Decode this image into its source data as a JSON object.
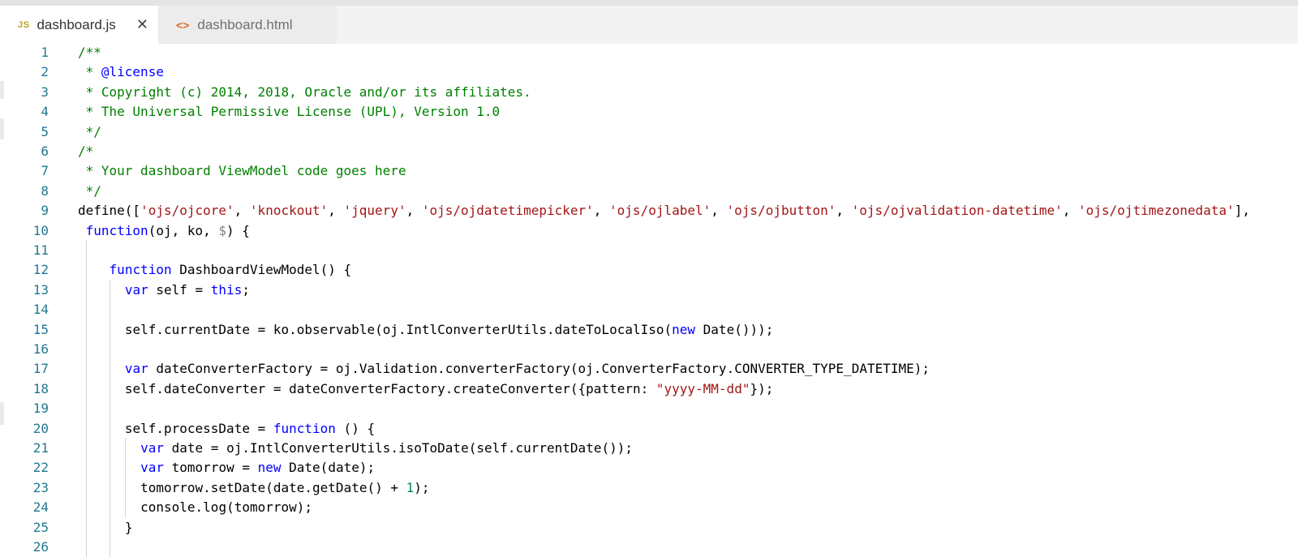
{
  "tabs": [
    {
      "icon": "JS",
      "label": "dashboard.js",
      "active": true,
      "close": "✕"
    },
    {
      "icon": "<>",
      "label": "dashboard.html",
      "active": false
    }
  ],
  "editor": {
    "lines": [
      {
        "num": "1",
        "indent": 0,
        "tokens": [
          {
            "t": "c",
            "v": "/**"
          }
        ]
      },
      {
        "num": "2",
        "indent": 1,
        "tokens": [
          {
            "t": "c",
            "v": "* "
          },
          {
            "t": "g",
            "v": "@license"
          }
        ]
      },
      {
        "num": "3",
        "indent": 1,
        "tokens": [
          {
            "t": "c",
            "v": "* Copyright (c) 2014, 2018, Oracle and/or its affiliates."
          }
        ]
      },
      {
        "num": "4",
        "indent": 1,
        "tokens": [
          {
            "t": "c",
            "v": "* The Universal Permissive License (UPL), Version 1.0"
          }
        ]
      },
      {
        "num": "5",
        "indent": 1,
        "tokens": [
          {
            "t": "c",
            "v": "*/"
          }
        ]
      },
      {
        "num": "6",
        "indent": 0,
        "tokens": [
          {
            "t": "c",
            "v": "/*"
          }
        ]
      },
      {
        "num": "7",
        "indent": 1,
        "tokens": [
          {
            "t": "c",
            "v": "* Your dashboard ViewModel code goes here"
          }
        ]
      },
      {
        "num": "8",
        "indent": 1,
        "tokens": [
          {
            "t": "c",
            "v": "*/"
          }
        ]
      },
      {
        "num": "9",
        "indent": 0,
        "tokens": [
          {
            "t": "p",
            "v": "define(["
          },
          {
            "t": "s",
            "v": "'ojs/ojcore'"
          },
          {
            "t": "p",
            "v": ", "
          },
          {
            "t": "s",
            "v": "'knockout'"
          },
          {
            "t": "p",
            "v": ", "
          },
          {
            "t": "s",
            "v": "'jquery'"
          },
          {
            "t": "p",
            "v": ", "
          },
          {
            "t": "s",
            "v": "'ojs/ojdatetimepicker'"
          },
          {
            "t": "p",
            "v": ", "
          },
          {
            "t": "s",
            "v": "'ojs/ojlabel'"
          },
          {
            "t": "p",
            "v": ", "
          },
          {
            "t": "s",
            "v": "'ojs/ojbutton'"
          },
          {
            "t": "p",
            "v": ", "
          },
          {
            "t": "s",
            "v": "'ojs/ojvalidation-datetime'"
          },
          {
            "t": "p",
            "v": ", "
          },
          {
            "t": "s",
            "v": "'ojs/ojtimezonedata'"
          },
          {
            "t": "p",
            "v": "],"
          }
        ]
      },
      {
        "num": "10",
        "indent": 1,
        "tokens": [
          {
            "t": "k",
            "v": "function"
          },
          {
            "t": "p",
            "v": "(oj, ko, "
          },
          {
            "t": "d",
            "v": "$"
          },
          {
            "t": "p",
            "v": ") {"
          }
        ]
      },
      {
        "num": "11",
        "indent": 1,
        "guides": [
          1
        ],
        "tokens": []
      },
      {
        "num": "12",
        "indent": 4,
        "guides": [
          1
        ],
        "tokens": [
          {
            "t": "k",
            "v": "function"
          },
          {
            "t": "p",
            "v": " DashboardViewModel() {"
          }
        ]
      },
      {
        "num": "13",
        "indent": 6,
        "guides": [
          1,
          4
        ],
        "tokens": [
          {
            "t": "k",
            "v": "var"
          },
          {
            "t": "p",
            "v": " self = "
          },
          {
            "t": "k",
            "v": "this"
          },
          {
            "t": "p",
            "v": ";"
          }
        ]
      },
      {
        "num": "14",
        "indent": 6,
        "guides": [
          1,
          4
        ],
        "tokens": []
      },
      {
        "num": "15",
        "indent": 6,
        "guides": [
          1,
          4
        ],
        "tokens": [
          {
            "t": "p",
            "v": "self.currentDate = ko.observable(oj.IntlConverterUtils.dateToLocalIso("
          },
          {
            "t": "k",
            "v": "new"
          },
          {
            "t": "p",
            "v": " Date()));"
          }
        ]
      },
      {
        "num": "16",
        "indent": 6,
        "guides": [
          1,
          4
        ],
        "tokens": []
      },
      {
        "num": "17",
        "indent": 6,
        "guides": [
          1,
          4
        ],
        "tokens": [
          {
            "t": "k",
            "v": "var"
          },
          {
            "t": "p",
            "v": " dateConverterFactory = oj.Validation.converterFactory(oj.ConverterFactory.CONVERTER_TYPE_DATETIME);"
          }
        ]
      },
      {
        "num": "18",
        "indent": 6,
        "guides": [
          1,
          4
        ],
        "tokens": [
          {
            "t": "p",
            "v": "self.dateConverter = dateConverterFactory.createConverter({pattern: "
          },
          {
            "t": "s",
            "v": "\"yyyy-MM-dd\""
          },
          {
            "t": "p",
            "v": "});"
          }
        ]
      },
      {
        "num": "19",
        "indent": 6,
        "guides": [
          1,
          4
        ],
        "tokens": []
      },
      {
        "num": "20",
        "indent": 6,
        "guides": [
          1,
          4
        ],
        "tokens": [
          {
            "t": "p",
            "v": "self.processDate = "
          },
          {
            "t": "k",
            "v": "function"
          },
          {
            "t": "p",
            "v": " () {"
          }
        ]
      },
      {
        "num": "21",
        "indent": 8,
        "guides": [
          1,
          4,
          6
        ],
        "tokens": [
          {
            "t": "k",
            "v": "var"
          },
          {
            "t": "p",
            "v": " date = oj.IntlConverterUtils.isoToDate(self.currentDate());"
          }
        ]
      },
      {
        "num": "22",
        "indent": 8,
        "guides": [
          1,
          4,
          6
        ],
        "tokens": [
          {
            "t": "k",
            "v": "var"
          },
          {
            "t": "p",
            "v": " tomorrow = "
          },
          {
            "t": "k",
            "v": "new"
          },
          {
            "t": "p",
            "v": " Date(date);"
          }
        ]
      },
      {
        "num": "23",
        "indent": 8,
        "guides": [
          1,
          4,
          6
        ],
        "tokens": [
          {
            "t": "p",
            "v": "tomorrow.setDate(date.getDate() + "
          },
          {
            "t": "n",
            "v": "1"
          },
          {
            "t": "p",
            "v": ");"
          }
        ]
      },
      {
        "num": "24",
        "indent": 8,
        "guides": [
          1,
          4,
          6
        ],
        "tokens": [
          {
            "t": "p",
            "v": "console.log(tomorrow);"
          }
        ]
      },
      {
        "num": "25",
        "indent": 6,
        "guides": [
          1,
          4
        ],
        "tokens": [
          {
            "t": "p",
            "v": "}"
          }
        ]
      },
      {
        "num": "26",
        "indent": 6,
        "guides": [
          1,
          4
        ],
        "tokens": []
      }
    ]
  },
  "colors": {
    "comment": "#008000",
    "keyword": "#0000ff",
    "string": "#a31515",
    "number": "#098658",
    "line_number": "#237893",
    "tab_active_bg": "#ffffff",
    "tab_inactive_bg": "#ececec"
  }
}
